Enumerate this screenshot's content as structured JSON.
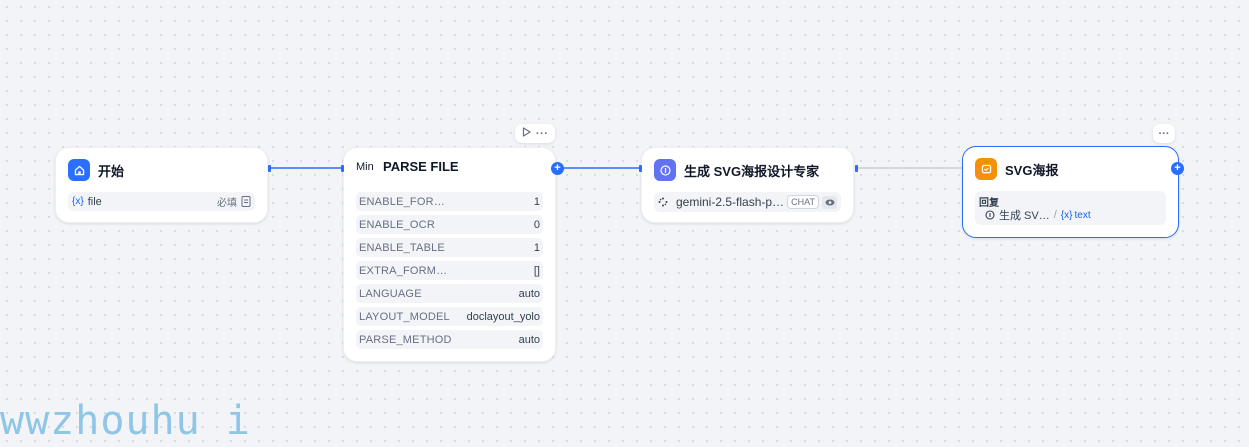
{
  "nodes": {
    "start": {
      "title": "开始",
      "var_icon": "{x}",
      "var_name": "file",
      "required": "必填"
    },
    "parse": {
      "logo_text": "Min",
      "title": "PARSE FILE",
      "params": [
        {
          "key": "ENABLE_FOR…",
          "value": "1"
        },
        {
          "key": "ENABLE_OCR",
          "value": "0"
        },
        {
          "key": "ENABLE_TABLE",
          "value": "1"
        },
        {
          "key": "EXTRA_FORM…",
          "value": "[]"
        },
        {
          "key": "LANGUAGE",
          "value": "auto"
        },
        {
          "key": "LAYOUT_MODEL",
          "value": "doclayout_yolo"
        },
        {
          "key": "PARSE_METHOD",
          "value": "auto"
        }
      ]
    },
    "llm": {
      "title": "生成 SVG海报设计专家",
      "model": "gemini-2.5-flash-p…",
      "mode_tag": "CHAT"
    },
    "answer": {
      "title": "SVG海报",
      "reply_label": "回复",
      "source_node": "生成 SV…",
      "separator": "/",
      "var_icon": "{x}",
      "var_name": "text"
    }
  },
  "toolbar": {
    "run_icon": "play-icon",
    "more_icon": "more-icon"
  },
  "colors": {
    "accent": "#296dff",
    "start_badge": "#2970ff",
    "llm_badge": "#6172f3",
    "answer_badge": "#f79009"
  },
  "watermark": "wwzhouhu i"
}
